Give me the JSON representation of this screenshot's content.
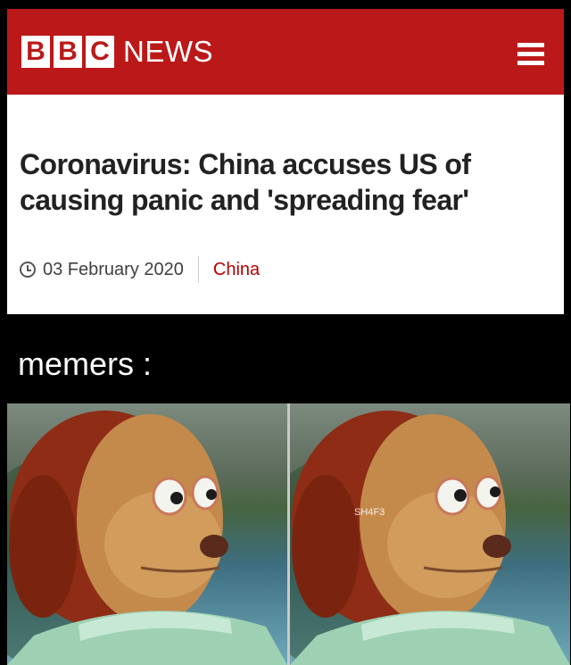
{
  "header": {
    "logo_letters": [
      "B",
      "B",
      "C"
    ],
    "logo_word": "NEWS",
    "brand_color": "#bb1919",
    "menu_icon": "hamburger-menu-icon"
  },
  "article": {
    "headline": "Coronavirus: China accuses US of causing panic and 'spreading fear'",
    "date": "03 February 2020",
    "category": "China",
    "clock_icon": "clock-icon"
  },
  "meme": {
    "caption": "memers :",
    "watermark": "SH4F3"
  }
}
